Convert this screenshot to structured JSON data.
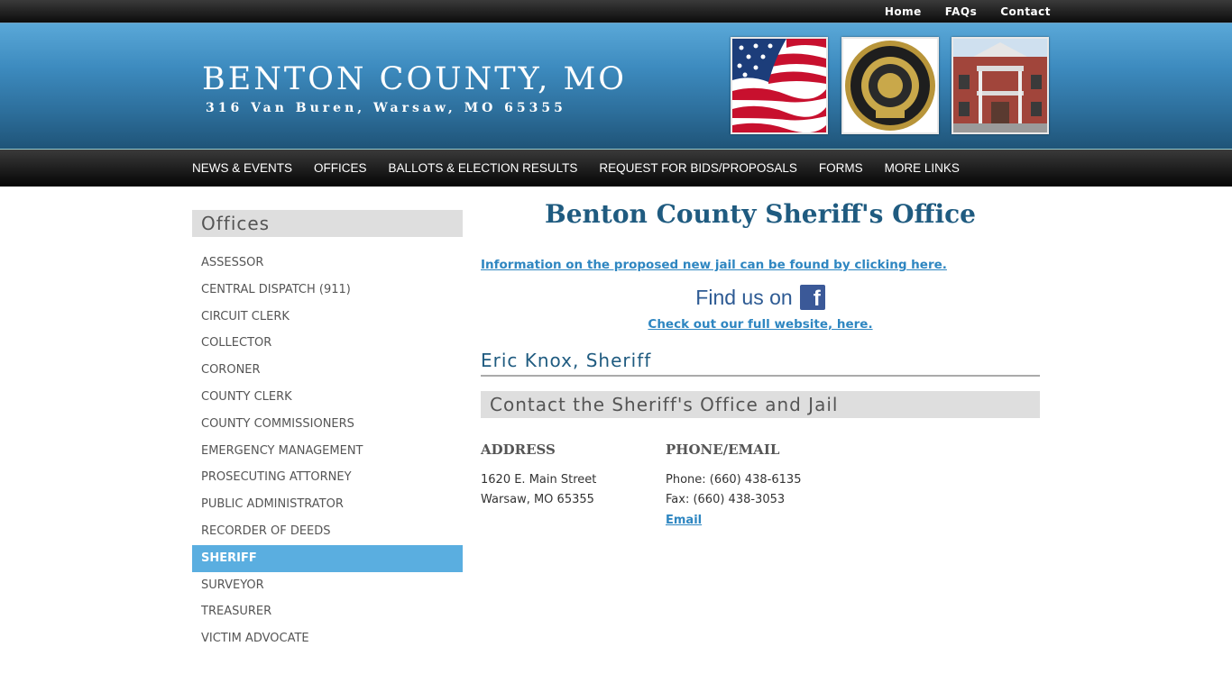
{
  "topnav": {
    "home": "Home",
    "faqs": "FAQs",
    "contact": "Contact"
  },
  "header": {
    "title": "BENTON COUNTY, MO",
    "address": "316 Van Buren, Warsaw, MO 65355"
  },
  "mainnav": [
    "NEWS & EVENTS",
    "OFFICES",
    "BALLOTS & ELECTION RESULTS",
    "REQUEST FOR BIDS/PROPOSALS",
    "FORMS",
    "MORE LINKS"
  ],
  "sidebar": {
    "heading": "Offices",
    "items": [
      "ASSESSOR",
      "CENTRAL DISPATCH (911)",
      "CIRCUIT CLERK",
      "COLLECTOR",
      "CORONER",
      "COUNTY CLERK",
      "COUNTY COMMISSIONERS",
      "EMERGENCY MANAGEMENT",
      "PROSECUTING ATTORNEY",
      "PUBLIC ADMINISTRATOR",
      "RECORDER OF DEEDS",
      "SHERIFF",
      "SURVEYOR",
      "TREASURER",
      "VICTIM ADVOCATE"
    ],
    "active": "SHERIFF"
  },
  "main": {
    "title": "Benton County Sheriff's Office",
    "jail_link": "Information on the proposed new jail can be found by clicking here.",
    "fb_text": "Find us on",
    "fb_letter": "f",
    "website_link": "Check out our full website, here.",
    "sheriff": "Eric Knox, Sheriff",
    "contact_heading": "Contact the Sheriff's Office and Jail",
    "address_label": "ADDRESS",
    "address_line1": "1620 E. Main Street",
    "address_line2": "Warsaw, MO 65355",
    "phone_label": "PHONE/EMAIL",
    "phone": "Phone: (660) 438-6135",
    "fax": "Fax: (660) 438-3053",
    "email": "Email"
  },
  "colors": {
    "accent": "#5aaee0",
    "link": "#2e86c1",
    "heading": "#1f5b80"
  },
  "icons": [
    "facebook-icon"
  ]
}
